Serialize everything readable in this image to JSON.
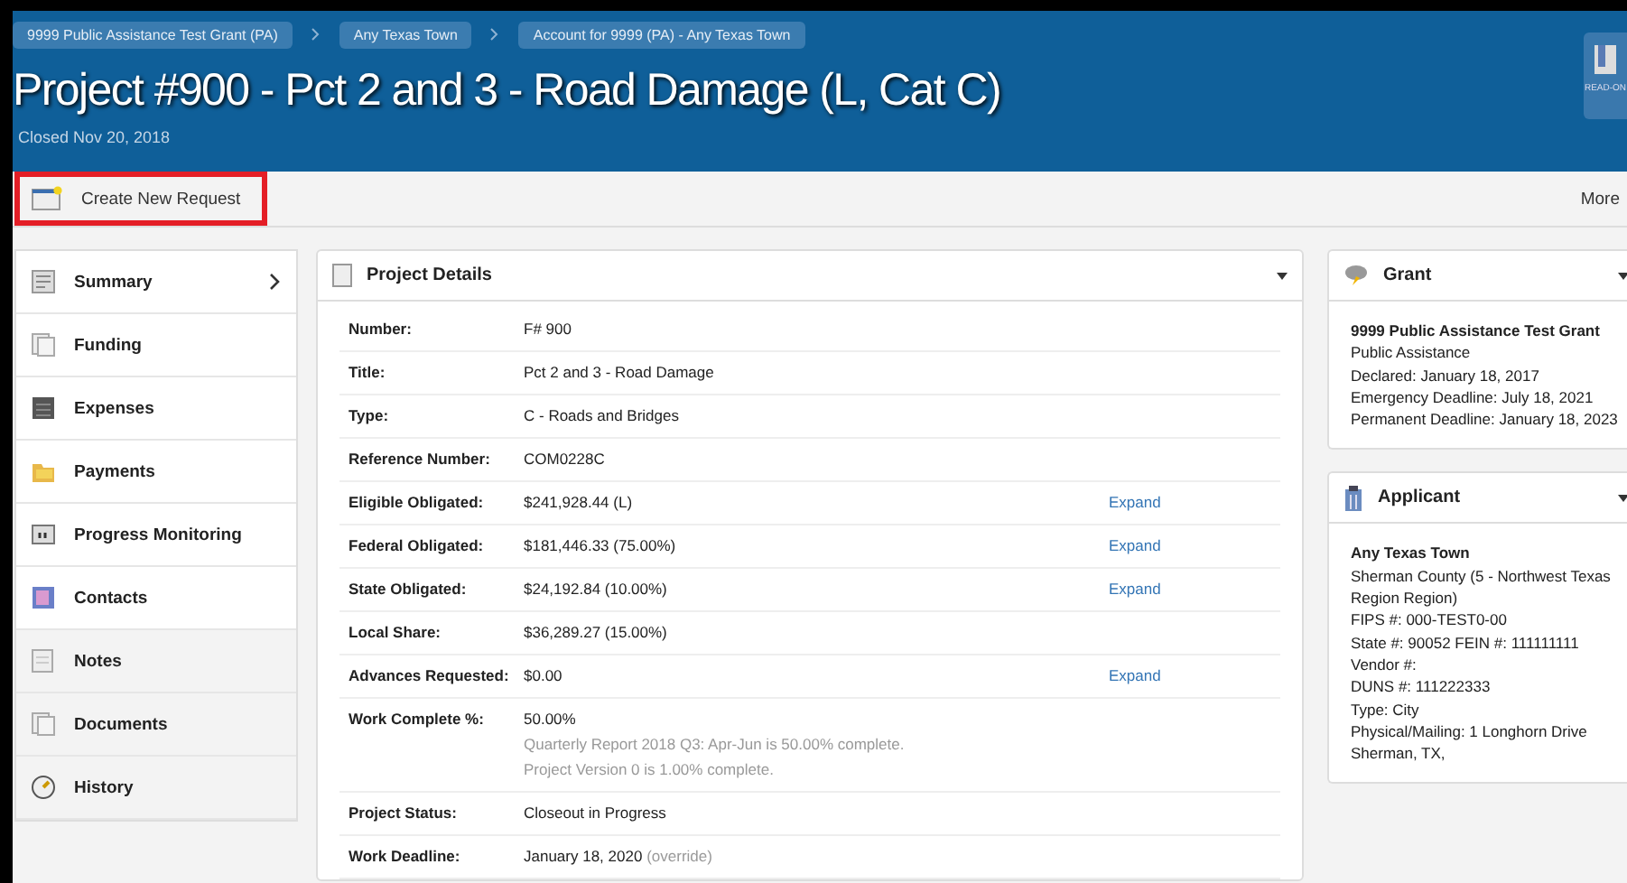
{
  "breadcrumbs": [
    "9999 Public Assistance Test Grant (PA)",
    "Any Texas Town",
    "Account for 9999 (PA) - Any Texas Town"
  ],
  "title": "Project #900 - Pct 2 and 3 - Road Damage (L, Cat C)",
  "subtitle": "Closed Nov 20, 2018",
  "read_only_button": {
    "label": "READ-ON"
  },
  "toolbar": {
    "create_button": {
      "label": "Create New Request",
      "highlighted": true
    },
    "more": "More"
  },
  "sidebar": {
    "items": [
      {
        "label": "Summary",
        "selected": true,
        "disabled": false
      },
      {
        "label": "Funding",
        "selected": false,
        "disabled": false
      },
      {
        "label": "Expenses",
        "selected": false,
        "disabled": false
      },
      {
        "label": "Payments",
        "selected": false,
        "disabled": false
      },
      {
        "label": "Progress Monitoring",
        "selected": false,
        "disabled": false
      },
      {
        "label": "Contacts",
        "selected": false,
        "disabled": false
      },
      {
        "label": "Notes",
        "selected": false,
        "disabled": true
      },
      {
        "label": "Documents",
        "selected": false,
        "disabled": true
      },
      {
        "label": "History",
        "selected": false,
        "disabled": true
      }
    ]
  },
  "project_details": {
    "title": "Project Details",
    "rows": [
      {
        "label": "Number:",
        "value": "F# 900"
      },
      {
        "label": "Title:",
        "value": "Pct 2 and 3 - Road Damage"
      },
      {
        "label": "Type:",
        "value": "C - Roads and Bridges"
      },
      {
        "label": "Reference Number:",
        "value": "COM0228C"
      },
      {
        "label": "Eligible Obligated:",
        "value": "$241,928.44 (L)",
        "link": "Expand"
      },
      {
        "label": "Federal Obligated:",
        "value": "$181,446.33 (75.00%)",
        "link": "Expand"
      },
      {
        "label": "State Obligated:",
        "value": "$24,192.84 (10.00%)",
        "link": "Expand"
      },
      {
        "label": "Local Share:",
        "value": "$36,289.27 (15.00%)"
      },
      {
        "label": "Advances Requested:",
        "value": "$0.00",
        "link": "Expand"
      },
      {
        "label": "Work Complete %:",
        "value": "50.00%",
        "notes": [
          "Quarterly Report 2018 Q3: Apr-Jun is 50.00% complete.",
          "Project Version 0 is 1.00% complete."
        ]
      },
      {
        "label": "Project Status:",
        "value": "Closeout in Progress"
      },
      {
        "label": "Work Deadline:",
        "value": "January 18, 2020",
        "suffix": "(override)"
      }
    ]
  },
  "grant": {
    "title": "Grant",
    "name": "9999 Public Assistance Test Grant",
    "lines": [
      "Public Assistance",
      "Declared: January 18, 2017",
      "Emergency Deadline: July 18, 2021",
      "Permanent Deadline: January 18, 2023"
    ]
  },
  "applicant": {
    "title": "Applicant",
    "name": "Any Texas Town",
    "lines": [
      "Sherman County (5 - Northwest Texas Region Region)",
      "FIPS #: 000-TEST0-00",
      "State #: 90052 FEIN #: 111111111",
      "Vendor #:",
      "DUNS #: 111222333",
      "Type: City",
      "Physical/Mailing: 1 Longhorn Drive",
      "Sherman, TX,"
    ]
  }
}
